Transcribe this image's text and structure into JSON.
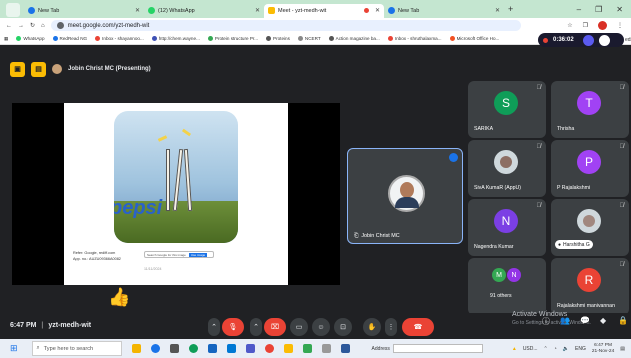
{
  "tabs": [
    {
      "title": "New Tab",
      "color": "#1a73e8"
    },
    {
      "title": "(12) WhatsApp",
      "color": "#25d366"
    },
    {
      "title": "Meet - yzt-medh-wit",
      "color": "#fbbc04",
      "active": true
    },
    {
      "title": "New Tab",
      "color": "#1a73e8"
    }
  ],
  "window": {
    "min": "–",
    "max": "❐",
    "close": "✕"
  },
  "address": {
    "url": "meet.google.com/yzt-medh-wit"
  },
  "bookmarks": [
    "WhatsApp",
    "RedRead NG",
    "Inbox - shayannoo...",
    "http://chem.wayne...",
    "Protein structure Pr...",
    "Proteins",
    "NCERT",
    "Action magazine ba...",
    "Inbox - shruthalaxma...",
    "Microsoft Office Ho..."
  ],
  "recording": {
    "time": "0:36:02",
    "edge_text": "eds"
  },
  "meeting": {
    "presenter_label": "Jobin Christ MC (Presenting)",
    "code": "yzt-medh-wit",
    "time": "6:47 PM",
    "separator": "|"
  },
  "slide": {
    "ref_line1": "Refer: Google, rediff.com",
    "ref_line2": "App. no.: AUZU09366A0082",
    "caption_text": "Search Google for this image",
    "caption_btn": "Use image",
    "date": "11/11/2024",
    "ad_text": "pepsi"
  },
  "presenter_tile": {
    "name": "Jobin Christ MC"
  },
  "participants": [
    {
      "name": "SARIKA",
      "initial": "S",
      "color": "#0f9d58",
      "photo": false
    },
    {
      "name": "Thrisha",
      "initial": "T",
      "color": "#a142f4",
      "photo": false
    },
    {
      "name": "SivA KumaR (AppU)",
      "initial": "",
      "color": "#cfd8dc",
      "photo": true
    },
    {
      "name": "P Rajalakshmi",
      "initial": "P",
      "color": "#a142f4",
      "photo": false
    },
    {
      "name": "Nagendra Kumar",
      "initial": "N",
      "color": "#7b3fe4",
      "photo": false
    },
    {
      "name": "Harshitha G",
      "initial": "",
      "color": "#cfd8dc",
      "photo": true,
      "chip": true
    },
    {
      "name": "91 others",
      "initial": "M",
      "initial2": "N",
      "color": "#34a853",
      "color2": "#9334e6",
      "photo": false,
      "group": true
    },
    {
      "name": "Rajalakshmi manivannan",
      "initial": "R",
      "color": "#ea4335",
      "photo": false
    }
  ],
  "controls": [
    "mic-off",
    "raise-hand",
    "camera-off",
    "captions",
    "emoji",
    "present",
    "hand",
    "more",
    "leave"
  ],
  "activate": {
    "line1": "Activate Windows",
    "line2": "Go to Settings to activate Windows."
  },
  "right_controls": [
    "info",
    "people",
    "chat",
    "activities",
    "lock"
  ],
  "taskbar": {
    "search_placeholder": "Type here to search",
    "address_label": "Address",
    "stock": "USD...",
    "lang": "ENG",
    "time": "6:47 PM",
    "date": "21-Nov-24"
  }
}
